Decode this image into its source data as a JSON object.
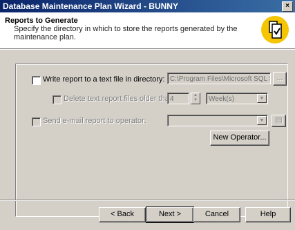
{
  "window": {
    "title": "Database Maintenance Plan Wizard - BUNNY",
    "close_glyph": "×"
  },
  "header": {
    "title": "Reports to Generate",
    "description": "Specify the directory in which to store the reports generated by the maintenance plan."
  },
  "report": {
    "write_label": "Write report to a text file in directory:",
    "directory_value": "C:\\Program Files\\Microsoft SQL Se",
    "browse_label": "...",
    "delete_label": "Delete text report files older than:",
    "age_value": "4",
    "unit_value": "Week(s)",
    "email_label": "Send e-mail report to operator:",
    "operator_value": "",
    "new_operator_label": "New Operator..."
  },
  "buttons": {
    "back": "< Back",
    "next": "Next >",
    "cancel": "Cancel",
    "help": "Help"
  },
  "colors": {
    "title_bar": "#0a246a",
    "badge": "#f4c500",
    "face": "#d4d0c8"
  }
}
